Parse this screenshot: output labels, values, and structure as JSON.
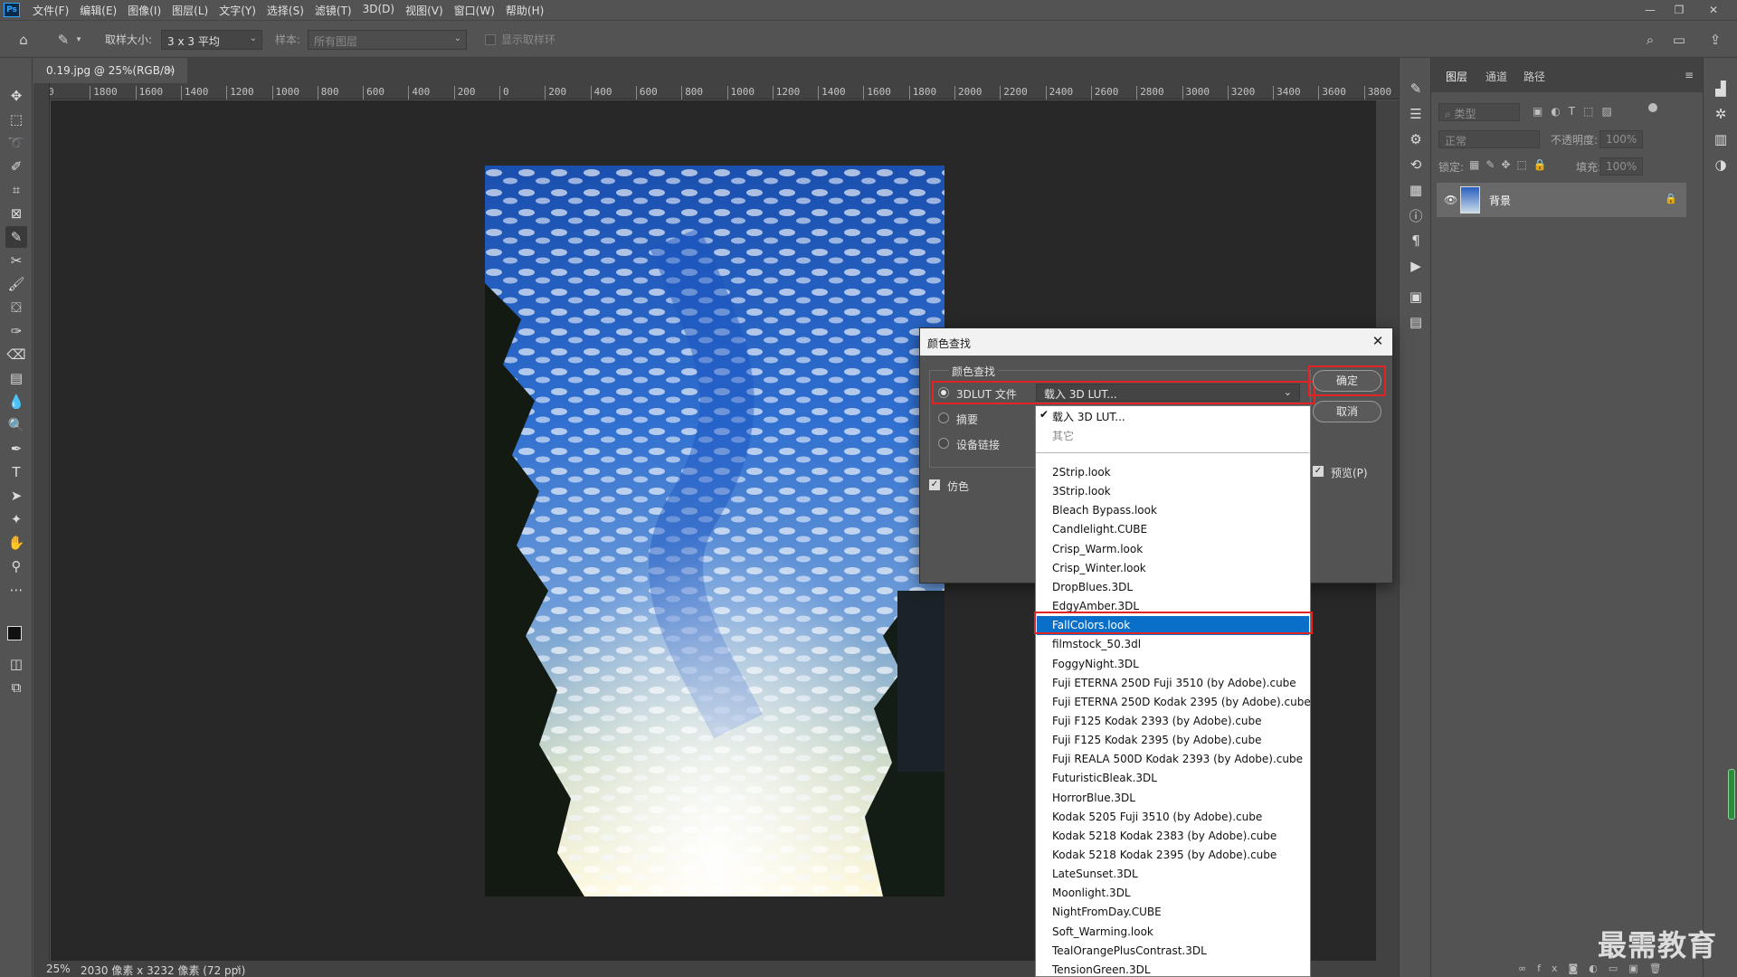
{
  "app": {
    "logo": "Ps"
  },
  "menu": [
    "文件(F)",
    "编辑(E)",
    "图像(I)",
    "图层(L)",
    "文字(Y)",
    "选择(S)",
    "滤镜(T)",
    "3D(D)",
    "视图(V)",
    "窗口(W)",
    "帮助(H)"
  ],
  "options_bar": {
    "sample_size_label": "取样大小:",
    "sample_size_value": "3 x 3 平均",
    "sample_label": "样本:",
    "sample_value": "所有图层",
    "show_ring_label": "显示取样环"
  },
  "document": {
    "tab_title": "0.19.jpg @ 25%(RGB/8)",
    "close_glyph": "×",
    "ruler_top": [
      "0",
      "1800",
      "1600",
      "1400",
      "1200",
      "1000",
      "800",
      "600",
      "400",
      "200",
      "0",
      "200",
      "400",
      "600",
      "800",
      "1000",
      "1200",
      "1400",
      "1600",
      "1800",
      "2000",
      "2200",
      "2400",
      "2600",
      "2800",
      "3000",
      "3200",
      "3400",
      "3600",
      "3800"
    ],
    "zoom": "25%",
    "doc_info": "2030 像素 x 3232 像素 (72 ppi)"
  },
  "layers_panel": {
    "tabs": [
      "图层",
      "通道",
      "路径"
    ],
    "filter_placeholder": "类型",
    "blend_mode": "正常",
    "opacity_label": "不透明度:",
    "opacity_value": "100%",
    "lock_label": "锁定:",
    "fill_label": "填充:",
    "fill_value": "100%",
    "layer_name": "背景"
  },
  "dialog": {
    "title": "颜色查找",
    "group_label": "颜色查找",
    "radio_3dlut": "3DLUT 文件",
    "radio_abstract": "摘要",
    "radio_device_link": "设备链接",
    "dither_label": "仿色",
    "lut_select_value": "载入 3D LUT...",
    "ok_label": "确定",
    "cancel_label": "取消",
    "preview_label": "预览(P)"
  },
  "lut_dropdown": {
    "header_items": [
      "载入 3D LUT...",
      "其它"
    ],
    "items": [
      "2Strip.look",
      "3Strip.look",
      "Bleach Bypass.look",
      "Candlelight.CUBE",
      "Crisp_Warm.look",
      "Crisp_Winter.look",
      "DropBlues.3DL",
      "EdgyAmber.3DL",
      "FallColors.look",
      "filmstock_50.3dl",
      "FoggyNight.3DL",
      "Fuji ETERNA 250D Fuji 3510 (by Adobe).cube",
      "Fuji ETERNA 250D Kodak 2395 (by Adobe).cube",
      "Fuji F125 Kodak 2393 (by Adobe).cube",
      "Fuji F125 Kodak 2395 (by Adobe).cube",
      "Fuji REALA 500D Kodak 2393 (by Adobe).cube",
      "FuturisticBleak.3DL",
      "HorrorBlue.3DL",
      "Kodak 5205 Fuji 3510 (by Adobe).cube",
      "Kodak 5218 Kodak 2383 (by Adobe).cube",
      "Kodak 5218 Kodak 2395 (by Adobe).cube",
      "LateSunset.3DL",
      "Moonlight.3DL",
      "NightFromDay.CUBE",
      "Soft_Warming.look",
      "TealOrangePlusContrast.3DL",
      "TensionGreen.3DL"
    ],
    "selected": "FallColors.look"
  },
  "watermark": "最需教育",
  "colors": {
    "accent": "#0a6fc9",
    "highlight": "#e42424",
    "canvas": "#282828",
    "ui": "#535353"
  }
}
